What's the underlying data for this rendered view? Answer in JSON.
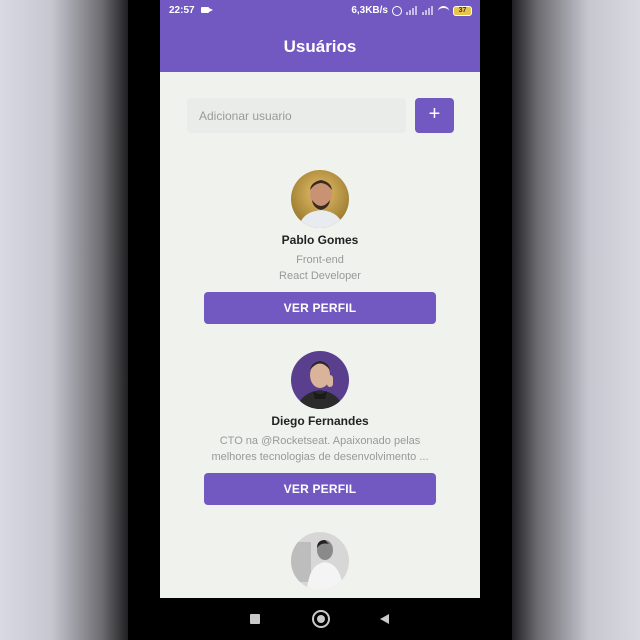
{
  "status_bar": {
    "time": "22:57",
    "network_speed": "6,3KB/s",
    "battery": "37"
  },
  "header": {
    "title": "Usuários"
  },
  "add_user": {
    "placeholder": "Adicionar usuario",
    "button_label": "+"
  },
  "users": [
    {
      "name": "Pablo Gomes",
      "bio_line1": "Front-end",
      "bio_line2": "React Developer",
      "button_label": "VER PERFIL"
    },
    {
      "name": "Diego Fernandes",
      "bio_line1": "CTO na @Rocketseat. Apaixonado pelas",
      "bio_line2": "melhores tecnologias de desenvolvimento ...",
      "button_label": "VER PERFIL"
    }
  ],
  "colors": {
    "primary": "#7159c1",
    "background": "#f0f2ee"
  },
  "icons": {
    "add": "plus-icon",
    "nav_recent": "square-icon",
    "nav_home": "circle-icon",
    "nav_back": "triangle-back-icon"
  }
}
